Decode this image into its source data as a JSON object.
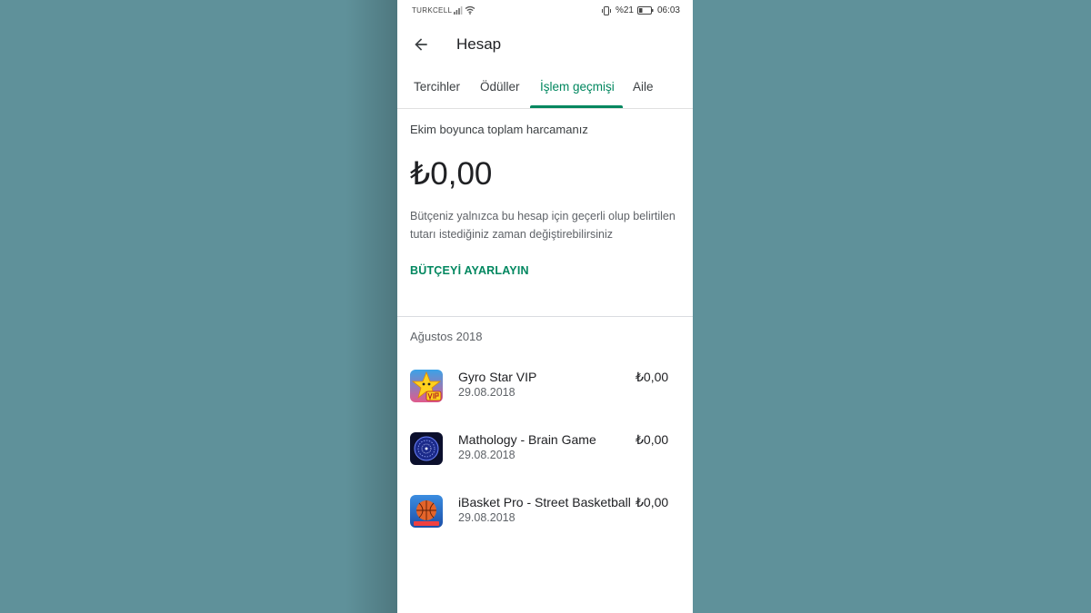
{
  "status_bar": {
    "carrier": "TURKCELL",
    "battery_text": "%21",
    "time": "06:03"
  },
  "header": {
    "title": "Hesap"
  },
  "tabs": [
    {
      "label": "Tercihler"
    },
    {
      "label": "Ödüller"
    },
    {
      "label": "İşlem geçmişi",
      "active": true
    },
    {
      "label": "Aile"
    }
  ],
  "budget": {
    "title": "Ekim boyunca toplam harcamanız",
    "amount": "₺0,00",
    "description": "Bütçeniz yalnızca bu hesap için geçerli olup belirtilen tutarı istediğiniz zaman değiştirebilirsiniz",
    "button_label": "BÜTÇEYİ AYARLAYIN"
  },
  "history": {
    "month": "Ağustos 2018",
    "items": [
      {
        "name": "Gyro Star VIP",
        "date": "29.08.2018",
        "price": "₺0,00",
        "icon": "gyro-star-app-icon"
      },
      {
        "name": "Mathology - Brain Game",
        "date": "29.08.2018",
        "price": "₺0,00",
        "icon": "mathology-app-icon"
      },
      {
        "name": "iBasket Pro - Street Basketball",
        "date": "29.08.2018",
        "price": "₺0,00",
        "icon": "ibasket-app-icon"
      }
    ]
  },
  "colors": {
    "accent": "#01875f",
    "background": "#5f919a"
  }
}
